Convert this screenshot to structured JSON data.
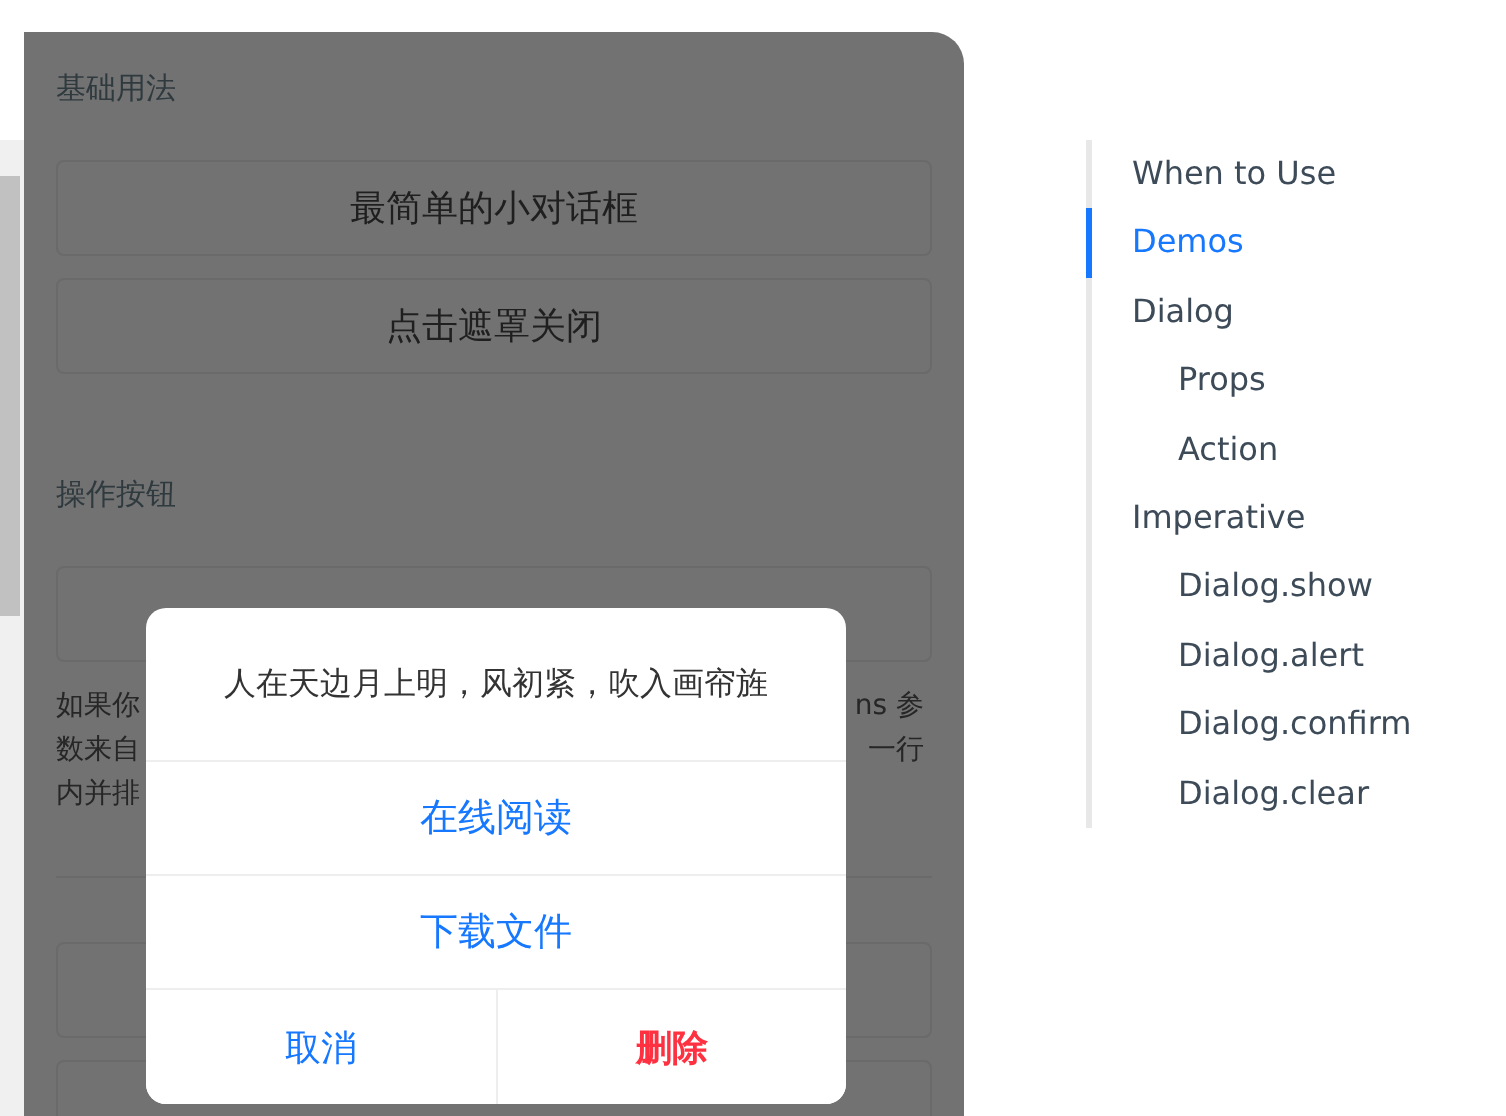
{
  "demo": {
    "section_1_title": "基础用法",
    "buttons": [
      "最简单的小对话框",
      "点击遮罩关闭"
    ],
    "section_2_title": "操作按钮",
    "description_fragments": [
      {
        "left": "如果你",
        "right": "ns 参"
      },
      {
        "left": "数来自",
        "right": "一行"
      },
      {
        "left": "内并排"
      }
    ]
  },
  "dialog": {
    "message": "人在天边月上明，风初紧，吹入画帘旌",
    "actions": [
      {
        "label": "在线阅读"
      },
      {
        "label": "下载文件"
      }
    ],
    "footer_actions": [
      {
        "label": "取消",
        "kind": "default"
      },
      {
        "label": "删除",
        "kind": "danger"
      }
    ]
  },
  "toc": [
    {
      "label": "When to Use",
      "selected": false
    },
    {
      "label": "Demos",
      "selected": true
    },
    {
      "label": "Dialog",
      "selected": false,
      "children": [
        {
          "label": "Props",
          "selected": false
        },
        {
          "label": "Action",
          "selected": false
        }
      ]
    },
    {
      "label": "Imperative",
      "selected": false,
      "children": [
        {
          "label": "Dialog.show",
          "selected": false
        },
        {
          "label": "Dialog.alert",
          "selected": false
        },
        {
          "label": "Dialog.confirm",
          "selected": false
        },
        {
          "label": "Dialog.clear",
          "selected": false
        }
      ]
    }
  ]
}
